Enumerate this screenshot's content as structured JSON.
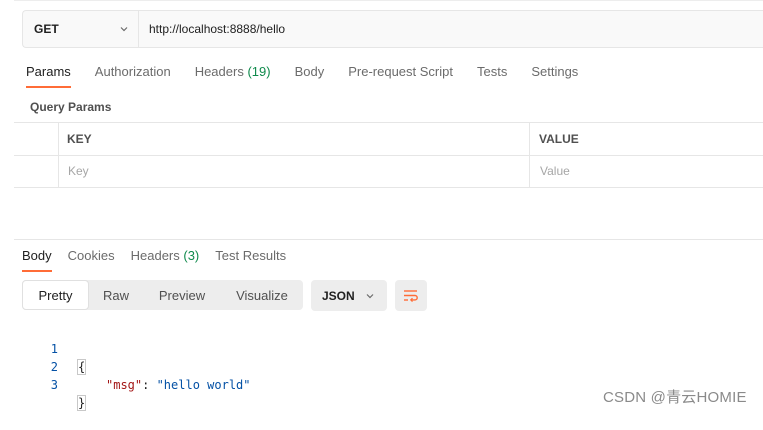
{
  "request": {
    "method": "GET",
    "url": "http://localhost:8888/hello"
  },
  "request_tabs": [
    {
      "label": "Params",
      "active": true
    },
    {
      "label": "Authorization"
    },
    {
      "label": "Headers",
      "count": "(19)"
    },
    {
      "label": "Body"
    },
    {
      "label": "Pre-request Script"
    },
    {
      "label": "Tests"
    },
    {
      "label": "Settings"
    }
  ],
  "query_params": {
    "title": "Query Params",
    "columns": [
      "KEY",
      "VALUE"
    ],
    "placeholders": [
      "Key",
      "Value"
    ]
  },
  "response_tabs": [
    {
      "label": "Body",
      "active": true
    },
    {
      "label": "Cookies"
    },
    {
      "label": "Headers",
      "count": "(3)"
    },
    {
      "label": "Test Results"
    }
  ],
  "view_modes": [
    "Pretty",
    "Raw",
    "Preview",
    "Visualize"
  ],
  "active_view": "Pretty",
  "format": "JSON",
  "code_lines": [
    {
      "num": "1",
      "open": "{"
    },
    {
      "num": "2",
      "key": "\"msg\"",
      "sep": ": ",
      "value": "\"hello world\""
    },
    {
      "num": "3",
      "close": "}"
    }
  ],
  "watermark": "CSDN @青云HOMIE",
  "colors": {
    "accent": "#ff6c37",
    "count_green": "#0f8a4c",
    "json_key": "#a31515",
    "json_string": "#0451a5"
  }
}
